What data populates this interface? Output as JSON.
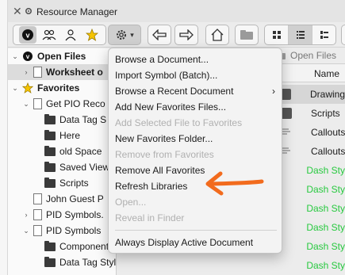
{
  "window": {
    "title": "Resource Manager"
  },
  "tree": {
    "rows": [
      {
        "label": "Open Files",
        "type": "section",
        "icon": "vectorworks-logo-icon"
      },
      {
        "label": "Worksheet o",
        "type": "file-selected",
        "icon": "worksheet-doc-icon"
      },
      {
        "label": "Favorites",
        "type": "section",
        "icon": "star-icon"
      },
      {
        "label": "Get PIO Reco",
        "type": "file",
        "icon": "doc-icon"
      },
      {
        "label": "Data Tag S",
        "type": "folder",
        "icon": "folder-icon"
      },
      {
        "label": "Here",
        "type": "folder",
        "icon": "folder-icon"
      },
      {
        "label": "old Space",
        "type": "folder",
        "icon": "folder-icon"
      },
      {
        "label": "Saved View",
        "type": "folder",
        "icon": "folder-icon"
      },
      {
        "label": "Scripts",
        "type": "folder",
        "icon": "folder-icon"
      },
      {
        "label": "John Guest P",
        "type": "file",
        "icon": "doc-icon"
      },
      {
        "label": "PID Symbols.",
        "type": "file",
        "icon": "doc-icon"
      },
      {
        "label": "PID Symbols",
        "type": "file",
        "icon": "doc-icon"
      },
      {
        "label": "Components",
        "type": "folder",
        "icon": "folder-icon"
      },
      {
        "label": "Data Tag Styles",
        "type": "folder",
        "icon": "folder-icon"
      }
    ]
  },
  "right_panel": {
    "breadcrumb": "Open Files",
    "column_header": "Name",
    "rows": [
      {
        "label": "Drawing",
        "color": "#1a1a1a"
      },
      {
        "label": "Scripts",
        "color": "#1a1a1a"
      },
      {
        "label": "Callouts",
        "color": "#1a1a1a"
      },
      {
        "label": "Callouts",
        "color": "#1a1a1a"
      },
      {
        "label": "Dash Sty",
        "color": "#27c93f"
      },
      {
        "label": "Dash Sty",
        "color": "#27c93f"
      },
      {
        "label": "Dash Sty",
        "color": "#27c93f"
      },
      {
        "label": "Dash Sty",
        "color": "#27c93f"
      },
      {
        "label": "Dash Sty",
        "color": "#27c93f"
      },
      {
        "label": "Dash Sty",
        "color": "#27c93f"
      },
      {
        "label": "Dash Sty",
        "color": "#27c93f"
      }
    ]
  },
  "menu": {
    "items": [
      {
        "label": "Browse a Document...",
        "enabled": true
      },
      {
        "label": "Import Symbol (Batch)...",
        "enabled": true
      },
      {
        "label": "Browse a Recent Document",
        "enabled": true,
        "submenu": true
      },
      {
        "label": "Add New Favorites Files...",
        "enabled": true
      },
      {
        "label": "Add Selected File to Favorites",
        "enabled": false
      },
      {
        "label": "New Favorites Folder...",
        "enabled": true
      },
      {
        "label": "Remove from Favorites",
        "enabled": false
      },
      {
        "label": "Remove All Favorites",
        "enabled": true
      },
      {
        "label": "Refresh Libraries",
        "enabled": true
      },
      {
        "label": "Open...",
        "enabled": false
      },
      {
        "label": "Reveal in Finder",
        "enabled": false
      },
      {
        "label": "Always Display Active Document",
        "enabled": true
      }
    ]
  },
  "colors": {
    "annotation_arrow": "#f26b1d",
    "accent_green": "#27c93f"
  }
}
